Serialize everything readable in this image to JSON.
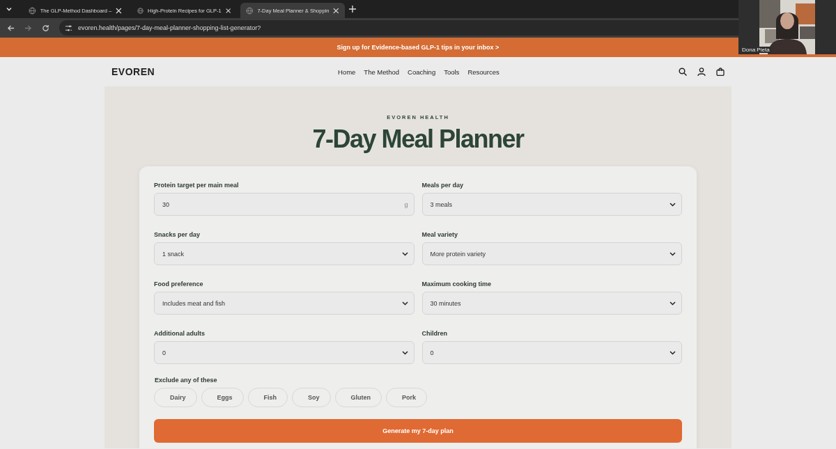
{
  "browser": {
    "tabs": [
      {
        "title": "The GLP-Method Dashboard –",
        "selected": false
      },
      {
        "title": "High-Protein Recipes for GLP-1",
        "selected": false
      },
      {
        "title": "7-Day Meal Planner & Shoppin",
        "selected": true
      }
    ],
    "url": "evoren.health/pages/7-day-meal-planner-shopping-list-generator?"
  },
  "video_call": {
    "participant": "Dona Pieta"
  },
  "announcement": "Sign up for Evidence-based GLP-1 tips in your inbox >",
  "header": {
    "logo": "EVOREN",
    "nav": [
      "Home",
      "The Method",
      "Coaching",
      "Tools",
      "Resources"
    ]
  },
  "hero": {
    "eyebrow": "EVOREN HEALTH",
    "title": "7-Day Meal Planner"
  },
  "form": {
    "fields": [
      {
        "kind": "number",
        "label": "Protein target per main meal",
        "value": "30",
        "unit": "g"
      },
      {
        "kind": "select",
        "label": "Meals per day",
        "value": "3 meals"
      },
      {
        "kind": "select",
        "label": "Snacks per day",
        "value": "1 snack"
      },
      {
        "kind": "select",
        "label": "Meal variety",
        "value": "More protein variety"
      },
      {
        "kind": "select",
        "label": "Food preference",
        "value": "Includes meat and fish"
      },
      {
        "kind": "select",
        "label": "Maximum cooking time",
        "value": "30 minutes"
      },
      {
        "kind": "select",
        "label": "Additional adults",
        "value": "0"
      },
      {
        "kind": "select",
        "label": "Children",
        "value": "0"
      }
    ],
    "exclude_label": "Exclude any of these",
    "exclusions": [
      {
        "label": "Dairy",
        "selected": false
      },
      {
        "label": "Eggs",
        "selected": false
      },
      {
        "label": "Fish",
        "selected": false
      },
      {
        "label": "Soy",
        "selected": false
      },
      {
        "label": "Gluten",
        "selected": false
      },
      {
        "label": "Pork",
        "selected": false
      }
    ],
    "submit": "Generate my 7-day plan"
  }
}
